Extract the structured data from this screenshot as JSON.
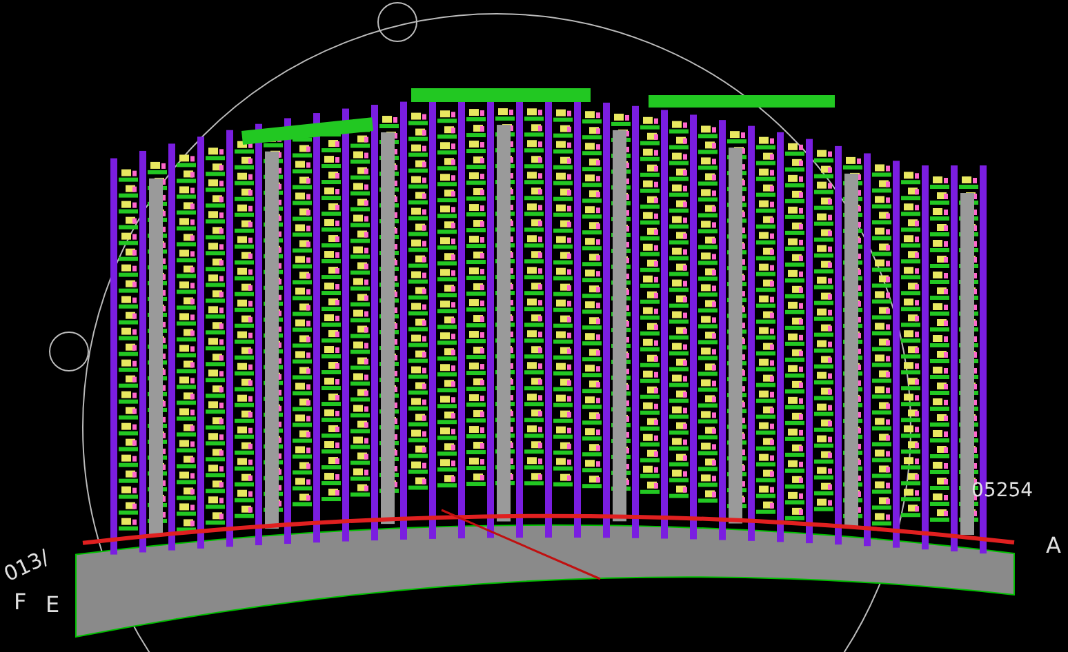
{
  "grid_labels": [
    {
      "text": "013/"
    },
    {
      "text": "F"
    },
    {
      "text": "E"
    },
    {
      "text": "05254"
    },
    {
      "text": "A"
    }
  ]
}
